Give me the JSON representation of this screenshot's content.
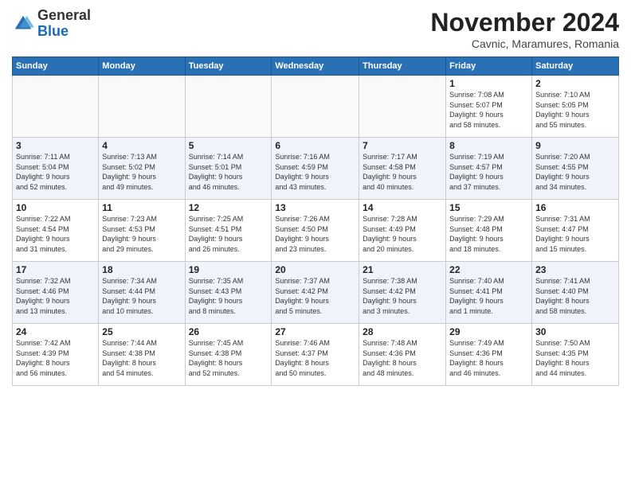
{
  "header": {
    "logo_general": "General",
    "logo_blue": "Blue",
    "month_title": "November 2024",
    "subtitle": "Cavnic, Maramures, Romania"
  },
  "weekdays": [
    "Sunday",
    "Monday",
    "Tuesday",
    "Wednesday",
    "Thursday",
    "Friday",
    "Saturday"
  ],
  "weeks": [
    [
      {
        "day": "",
        "info": ""
      },
      {
        "day": "",
        "info": ""
      },
      {
        "day": "",
        "info": ""
      },
      {
        "day": "",
        "info": ""
      },
      {
        "day": "",
        "info": ""
      },
      {
        "day": "1",
        "info": "Sunrise: 7:08 AM\nSunset: 5:07 PM\nDaylight: 9 hours\nand 58 minutes."
      },
      {
        "day": "2",
        "info": "Sunrise: 7:10 AM\nSunset: 5:05 PM\nDaylight: 9 hours\nand 55 minutes."
      }
    ],
    [
      {
        "day": "3",
        "info": "Sunrise: 7:11 AM\nSunset: 5:04 PM\nDaylight: 9 hours\nand 52 minutes."
      },
      {
        "day": "4",
        "info": "Sunrise: 7:13 AM\nSunset: 5:02 PM\nDaylight: 9 hours\nand 49 minutes."
      },
      {
        "day": "5",
        "info": "Sunrise: 7:14 AM\nSunset: 5:01 PM\nDaylight: 9 hours\nand 46 minutes."
      },
      {
        "day": "6",
        "info": "Sunrise: 7:16 AM\nSunset: 4:59 PM\nDaylight: 9 hours\nand 43 minutes."
      },
      {
        "day": "7",
        "info": "Sunrise: 7:17 AM\nSunset: 4:58 PM\nDaylight: 9 hours\nand 40 minutes."
      },
      {
        "day": "8",
        "info": "Sunrise: 7:19 AM\nSunset: 4:57 PM\nDaylight: 9 hours\nand 37 minutes."
      },
      {
        "day": "9",
        "info": "Sunrise: 7:20 AM\nSunset: 4:55 PM\nDaylight: 9 hours\nand 34 minutes."
      }
    ],
    [
      {
        "day": "10",
        "info": "Sunrise: 7:22 AM\nSunset: 4:54 PM\nDaylight: 9 hours\nand 31 minutes."
      },
      {
        "day": "11",
        "info": "Sunrise: 7:23 AM\nSunset: 4:53 PM\nDaylight: 9 hours\nand 29 minutes."
      },
      {
        "day": "12",
        "info": "Sunrise: 7:25 AM\nSunset: 4:51 PM\nDaylight: 9 hours\nand 26 minutes."
      },
      {
        "day": "13",
        "info": "Sunrise: 7:26 AM\nSunset: 4:50 PM\nDaylight: 9 hours\nand 23 minutes."
      },
      {
        "day": "14",
        "info": "Sunrise: 7:28 AM\nSunset: 4:49 PM\nDaylight: 9 hours\nand 20 minutes."
      },
      {
        "day": "15",
        "info": "Sunrise: 7:29 AM\nSunset: 4:48 PM\nDaylight: 9 hours\nand 18 minutes."
      },
      {
        "day": "16",
        "info": "Sunrise: 7:31 AM\nSunset: 4:47 PM\nDaylight: 9 hours\nand 15 minutes."
      }
    ],
    [
      {
        "day": "17",
        "info": "Sunrise: 7:32 AM\nSunset: 4:46 PM\nDaylight: 9 hours\nand 13 minutes."
      },
      {
        "day": "18",
        "info": "Sunrise: 7:34 AM\nSunset: 4:44 PM\nDaylight: 9 hours\nand 10 minutes."
      },
      {
        "day": "19",
        "info": "Sunrise: 7:35 AM\nSunset: 4:43 PM\nDaylight: 9 hours\nand 8 minutes."
      },
      {
        "day": "20",
        "info": "Sunrise: 7:37 AM\nSunset: 4:42 PM\nDaylight: 9 hours\nand 5 minutes."
      },
      {
        "day": "21",
        "info": "Sunrise: 7:38 AM\nSunset: 4:42 PM\nDaylight: 9 hours\nand 3 minutes."
      },
      {
        "day": "22",
        "info": "Sunrise: 7:40 AM\nSunset: 4:41 PM\nDaylight: 9 hours\nand 1 minute."
      },
      {
        "day": "23",
        "info": "Sunrise: 7:41 AM\nSunset: 4:40 PM\nDaylight: 8 hours\nand 58 minutes."
      }
    ],
    [
      {
        "day": "24",
        "info": "Sunrise: 7:42 AM\nSunset: 4:39 PM\nDaylight: 8 hours\nand 56 minutes."
      },
      {
        "day": "25",
        "info": "Sunrise: 7:44 AM\nSunset: 4:38 PM\nDaylight: 8 hours\nand 54 minutes."
      },
      {
        "day": "26",
        "info": "Sunrise: 7:45 AM\nSunset: 4:38 PM\nDaylight: 8 hours\nand 52 minutes."
      },
      {
        "day": "27",
        "info": "Sunrise: 7:46 AM\nSunset: 4:37 PM\nDaylight: 8 hours\nand 50 minutes."
      },
      {
        "day": "28",
        "info": "Sunrise: 7:48 AM\nSunset: 4:36 PM\nDaylight: 8 hours\nand 48 minutes."
      },
      {
        "day": "29",
        "info": "Sunrise: 7:49 AM\nSunset: 4:36 PM\nDaylight: 8 hours\nand 46 minutes."
      },
      {
        "day": "30",
        "info": "Sunrise: 7:50 AM\nSunset: 4:35 PM\nDaylight: 8 hours\nand 44 minutes."
      }
    ]
  ]
}
